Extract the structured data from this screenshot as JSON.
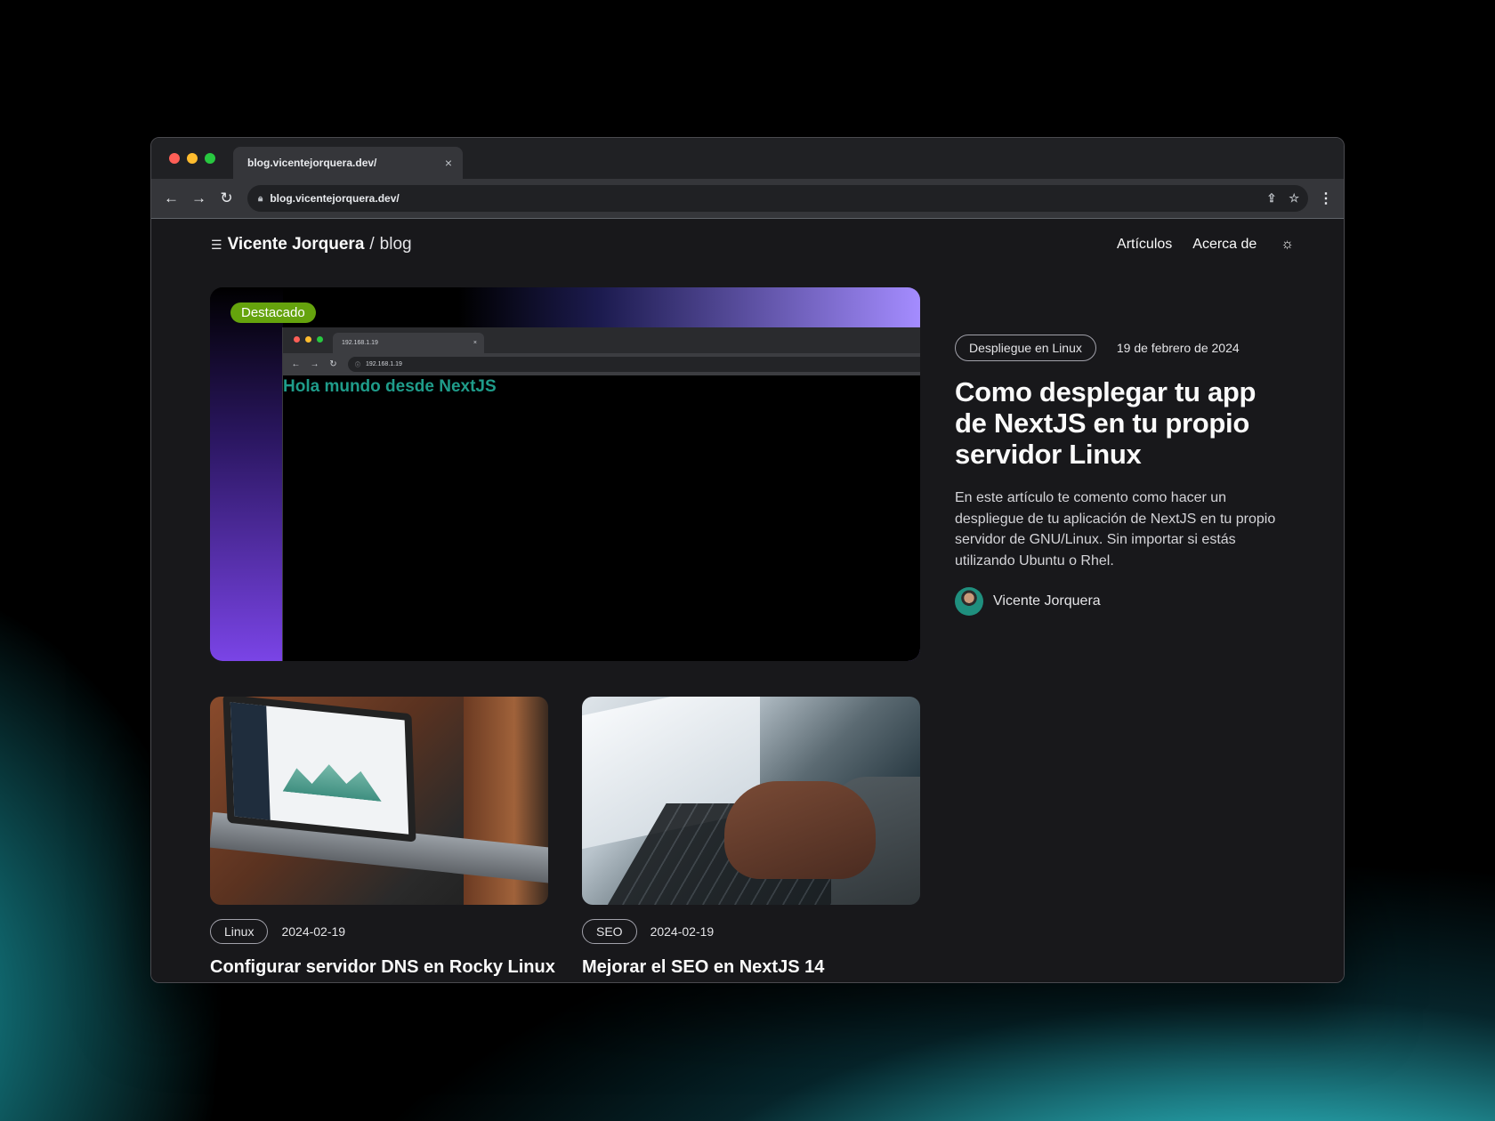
{
  "browser": {
    "tab_title": "blog.vicentejorquera.dev/",
    "tab_close": "×",
    "url": "blog.vicentejorquera.dev/",
    "traffic_lights": [
      "#ff5f57",
      "#febc2e",
      "#28c840"
    ],
    "icons": [
      "back-arrow-icon",
      "forward-arrow-icon",
      "reload-icon",
      "lock-icon",
      "share-icon",
      "star-icon",
      "kebab-menu-icon"
    ]
  },
  "site": {
    "brand_name": "Vicente Jorquera",
    "brand_sep": "/",
    "brand_suffix": "blog",
    "nav": [
      "Artículos",
      "Acerca de"
    ],
    "theme_toggle_icon": "sun-icon"
  },
  "featured": {
    "badge": "Destacado",
    "badge_color": "#65a30d",
    "image": {
      "mini_tab_title": "192.168.1.19",
      "mini_tab_close": "×",
      "mini_url": "192.168.1.19",
      "heading": "Hola mundo desde NextJS",
      "heading_color": "#1f9c8a"
    },
    "category": "Despliegue en Linux",
    "date": "19 de febrero de 2024",
    "title": "Como desplegar tu app de NextJS en tu propio servidor Linux",
    "description": "En este artículo te comento como hacer un despliegue de tu aplicación de NextJS en tu propio servidor de GNU/Linux. Sin importar si estás utilizando Ubuntu o Rhel.",
    "author": "Vicente Jorquera"
  },
  "posts": [
    {
      "category": "Linux",
      "date": "2024-02-19",
      "title": "Configurar servidor DNS en Rocky Linux"
    },
    {
      "category": "SEO",
      "date": "2024-02-19",
      "title": "Mejorar el SEO en NextJS 14"
    }
  ]
}
